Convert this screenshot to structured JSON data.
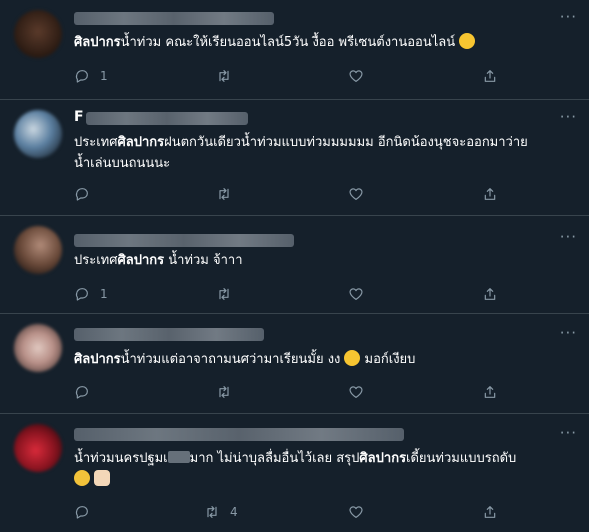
{
  "tweets": [
    {
      "text_bold": "ศิลปากร",
      "text_rest": "น้ำท่วม คณะให้เรียนออนไลน์5วัน งื้ออ พรีเซนต์งานออนไลน์",
      "emoji": "face-emoji",
      "reply_count": "1",
      "retweet_count": "",
      "like_count": ""
    },
    {
      "name_initial": "F",
      "line1_pre": "ประเทศ",
      "line1_bold": "ศิลปากร",
      "line1_rest": "ฝนตกวันเดียวน้ำท่วมแบบท่วมมมมมม อีกนิดน้องนุชจะออกมาว่าย",
      "line2": "น้ำเล่นบนถนนนะ",
      "reply_count": "",
      "retweet_count": "",
      "like_count": ""
    },
    {
      "text_pre": "ประเทศ",
      "text_bold": "ศิลปากร",
      "text_rest": " น้ำท่วม จ้าาา",
      "reply_count": "1",
      "retweet_count": "",
      "like_count": ""
    },
    {
      "text_bold": "ศิลปากร",
      "text_rest": "น้ำท่วมแต่อาจาถามนศว่ามาเรียนมั้ย งง",
      "text_after": " มอก์เงียบ",
      "reply_count": "",
      "retweet_count": "",
      "like_count": ""
    },
    {
      "line1_pre": "น้ำท่วมนครปฐมเ",
      "line1_mid": "มาก ไม่น่าบุลลื่มอื่นไว้เลย สรุป",
      "line1_bold": "ศิลปากร",
      "line1_rest": "เดี้ยนท่วมแบบรถดับ",
      "reply_count": "",
      "retweet_count": "4",
      "like_count": ""
    }
  ],
  "colors": {
    "background": "#15202b",
    "divider": "#38444d",
    "icon": "#8899a6",
    "text": "#ffffff"
  },
  "icons": [
    "reply-icon",
    "retweet-icon",
    "like-icon",
    "share-icon",
    "more-icon"
  ]
}
